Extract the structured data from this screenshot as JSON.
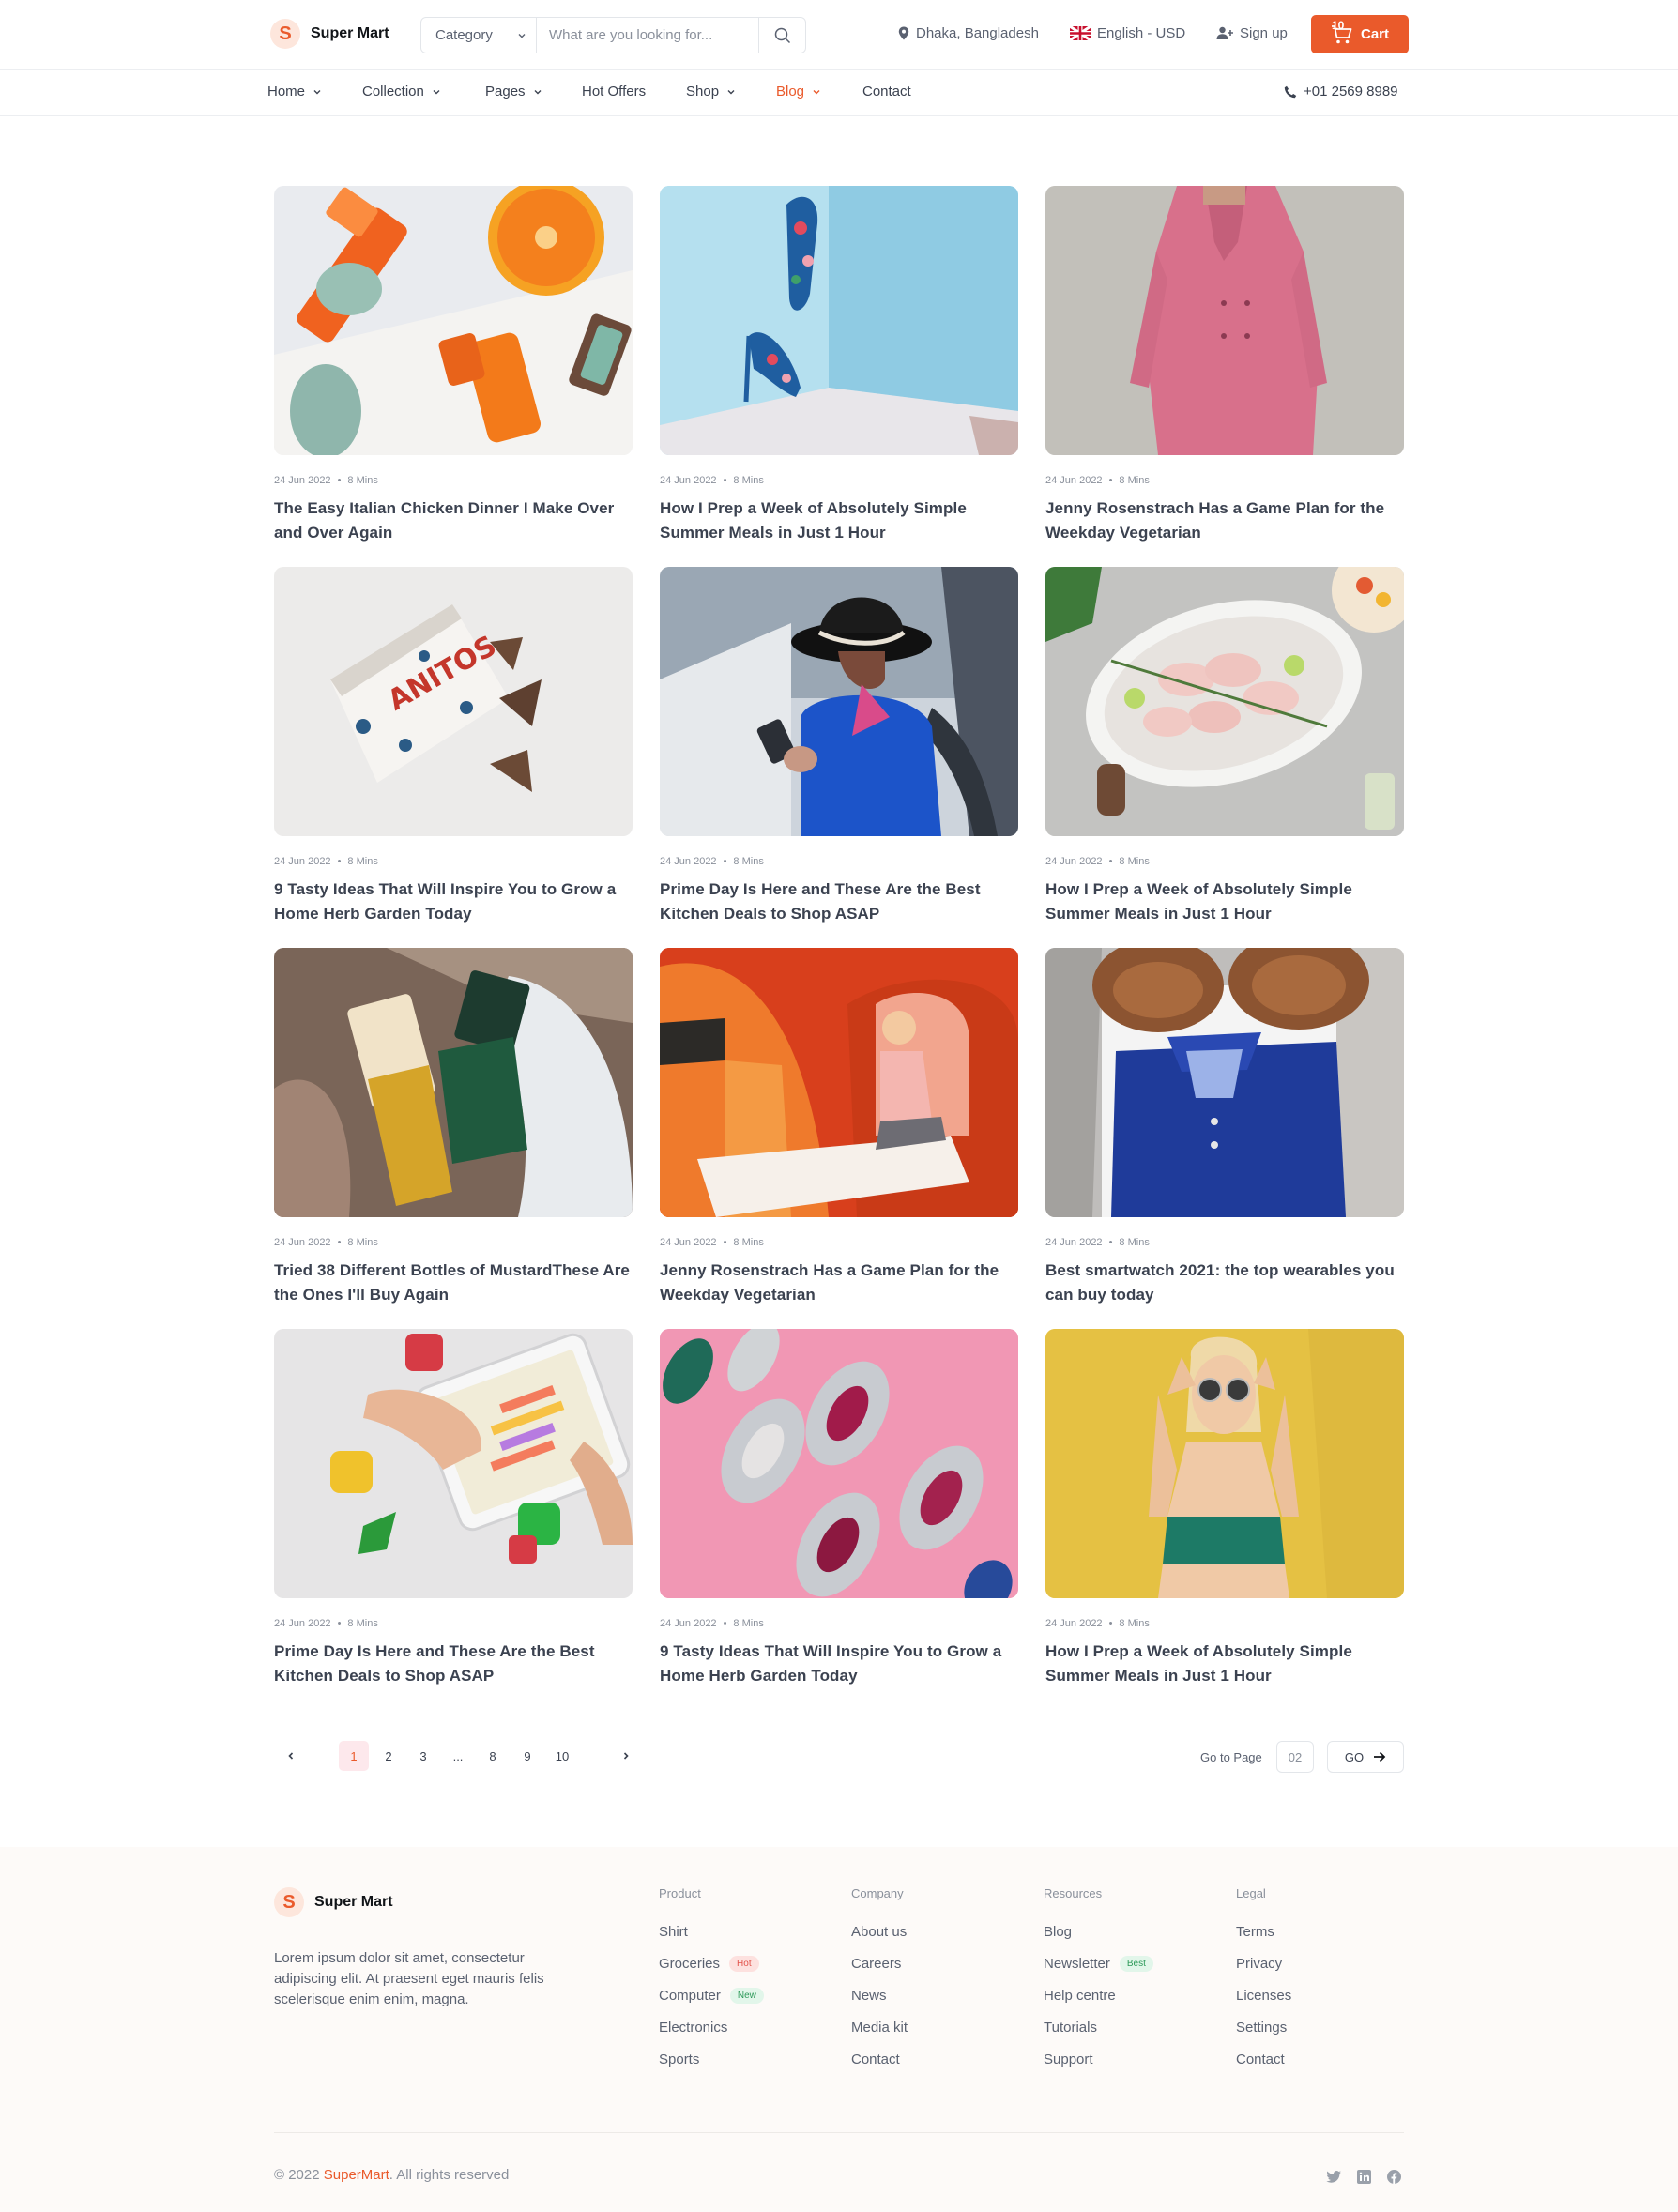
{
  "header": {
    "logo_letter": "S",
    "brand": "Super Mart",
    "search": {
      "category": "Category",
      "placeholder": "What are you looking for..."
    },
    "location": "Dhaka, Bangladesh",
    "language": "English - USD",
    "signup": "Sign up",
    "cart": {
      "label": "Cart",
      "count": "10"
    }
  },
  "nav": {
    "items": [
      {
        "label": "Home"
      },
      {
        "label": "Collection"
      },
      {
        "label": "Pages"
      },
      {
        "label": "Hot Offers"
      },
      {
        "label": "Shop"
      },
      {
        "label": "Blog"
      },
      {
        "label": "Contact"
      }
    ],
    "active": "Blog",
    "phone": "+01 2569 8989"
  },
  "posts": [
    {
      "date": "24 Jun 2022",
      "read": "8 Mins",
      "title": "The Easy Italian Chicken Dinner I Make Over and Over Again"
    },
    {
      "date": "24 Jun 2022",
      "read": "8 Mins",
      "title": "How I Prep a Week of Absolutely Simple Summer Meals in Just 1 Hour"
    },
    {
      "date": "24 Jun 2022",
      "read": "8 Mins",
      "title": "Jenny Rosenstrach Has a Game Plan for the Weekday Vegetarian"
    },
    {
      "date": "24 Jun 2022",
      "read": "8 Mins",
      "title": "9 Tasty Ideas That Will Inspire You to Grow a Home Herb Garden Today"
    },
    {
      "date": "24 Jun 2022",
      "read": "8 Mins",
      "title": "Prime Day Is Here and These Are the Best Kitchen Deals to Shop ASAP"
    },
    {
      "date": "24 Jun 2022",
      "read": "8 Mins",
      "title": "How I Prep a Week of Absolutely Simple Summer Meals in Just 1 Hour"
    },
    {
      "date": "24 Jun 2022",
      "read": "8 Mins",
      "title": "Tried 38 Different Bottles of MustardThese Are the Ones I'll Buy Again"
    },
    {
      "date": "24 Jun 2022",
      "read": "8 Mins",
      "title": "Jenny Rosenstrach Has a Game Plan for the Weekday Vegetarian"
    },
    {
      "date": "24 Jun 2022",
      "read": "8 Mins",
      "title": "Best smartwatch 2021: the top wearables you can buy today"
    },
    {
      "date": "24 Jun 2022",
      "read": "8 Mins",
      "title": "Prime Day Is Here and These Are the Best Kitchen Deals to Shop ASAP"
    },
    {
      "date": "24 Jun 2022",
      "read": "8 Mins",
      "title": "9 Tasty Ideas That Will Inspire You to Grow a Home Herb Garden Today"
    },
    {
      "date": "24 Jun 2022",
      "read": "8 Mins",
      "title": "How I Prep a Week of Absolutely Simple Summer Meals in Just 1 Hour"
    }
  ],
  "pagination": {
    "pages": [
      "1",
      "2",
      "3",
      "...",
      "8",
      "9",
      "10"
    ],
    "current": "1",
    "goto_label": "Go to Page",
    "goto_value": "02",
    "go_label": "GO"
  },
  "footer": {
    "brand": "Super Mart",
    "description": "Lorem ipsum dolor sit amet, consectetur adipiscing elit. At praesent eget mauris felis scelerisque enim enim, magna.",
    "columns": [
      {
        "title": "Product",
        "links": [
          "Shirt",
          "Groceries",
          "Computer",
          "Electronics",
          "Sports"
        ]
      },
      {
        "title": "Company",
        "links": [
          "About us",
          "Careers",
          "News",
          "Media kit",
          "Contact"
        ]
      },
      {
        "title": "Resources",
        "links": [
          "Blog",
          "Newsletter",
          "Help centre",
          "Tutorials",
          "Support"
        ]
      },
      {
        "title": "Legal",
        "links": [
          "Terms",
          "Privacy",
          "Licenses",
          "Settings",
          "Contact"
        ]
      }
    ],
    "badges": {
      "hot": "Hot",
      "new": "New",
      "best": "Best"
    },
    "copyright_prefix": "© 2022 ",
    "copyright_brand": "SuperMart",
    "copyright_suffix": ". All rights reserved",
    "social_icons": [
      "twitter-icon",
      "linkedin-icon",
      "facebook-icon"
    ]
  },
  "colors": {
    "accent": "#ea5a2b",
    "text": "#3b4250",
    "muted": "#8a909b",
    "footer_bg": "#fdfaf8"
  }
}
